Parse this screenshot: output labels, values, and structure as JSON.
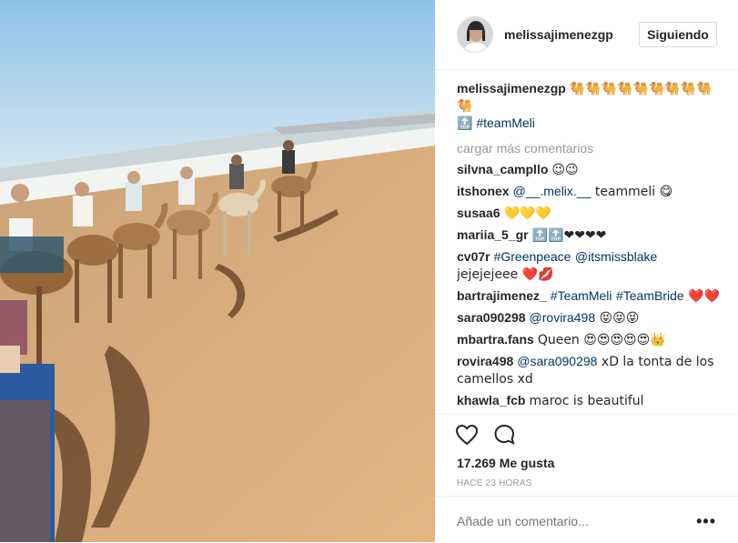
{
  "post": {
    "username": "melissajimenezgp",
    "follow_label": "Siguiendo",
    "caption_user": "melissajimenezgp",
    "caption_emojis": "🐫🐫🐫🐫🐫🐫🐫🐫🐫🐫",
    "caption_top": "🔝",
    "caption_tag": "#teamMeli",
    "load_more": "cargar más comentarios"
  },
  "comments": [
    {
      "user": "silvna_campllo",
      "parts": [
        {
          "t": "😉😉"
        }
      ]
    },
    {
      "user": "itshonex",
      "parts": [
        {
          "t": "@__.melix.__",
          "tag": true
        },
        {
          "t": " teammeli 😋"
        }
      ]
    },
    {
      "user": "susaa6",
      "parts": [
        {
          "t": "💛💛💛"
        }
      ]
    },
    {
      "user": "mariia_5_gr",
      "parts": [
        {
          "t": "🔝🔝❤❤❤❤"
        }
      ]
    },
    {
      "user": "cv07r",
      "parts": [
        {
          "t": "#Greenpeace",
          "tag": true
        },
        {
          "t": " "
        },
        {
          "t": "@itsmissblake",
          "tag": true
        },
        {
          "t": " jejejejeee ❤️💋"
        }
      ]
    },
    {
      "user": "bartrajimenez_",
      "parts": [
        {
          "t": "#TeamMeli",
          "tag": true
        },
        {
          "t": " "
        },
        {
          "t": "#TeamBride",
          "tag": true
        },
        {
          "t": " ❤️❤️"
        }
      ]
    },
    {
      "user": "sara090298",
      "parts": [
        {
          "t": "@rovira498",
          "tag": true
        },
        {
          "t": " 😝😝😝"
        }
      ]
    },
    {
      "user": "mbartra.fans",
      "parts": [
        {
          "t": "Queen 😍😍😍😍😍👑"
        }
      ]
    },
    {
      "user": "rovira498",
      "parts": [
        {
          "t": "@sara090298",
          "tag": true
        },
        {
          "t": " xD la tonta de los camellos xd"
        }
      ]
    },
    {
      "user": "khawla_fcb",
      "parts": [
        {
          "t": "maroc is beautiful"
        }
      ]
    }
  ],
  "likes": "17.269 Me gusta",
  "time": "HACE 23 HORAS",
  "add_comment": {
    "placeholder": "Añade un comentario..."
  },
  "icons": {
    "like": "heart-icon",
    "comment": "comment-icon",
    "more": "more-options-icon"
  }
}
